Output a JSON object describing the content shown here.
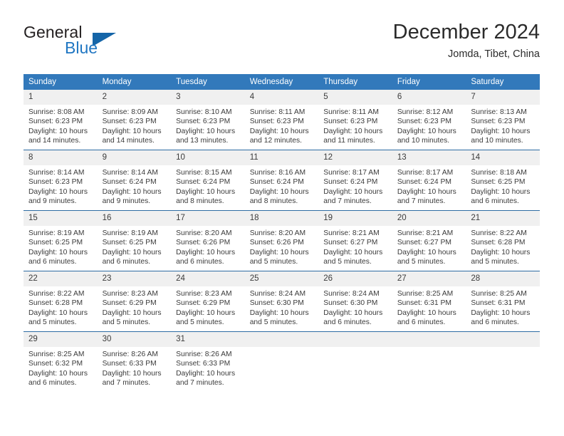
{
  "brand": {
    "name_top": "General",
    "name_bottom": "Blue",
    "accent_color": "#1565a8",
    "text_color": "#231f20"
  },
  "header": {
    "title": "December 2024",
    "subtitle": "Jomda, Tibet, China"
  },
  "theme": {
    "header_bg": "#3279bb",
    "row_divider": "#2e6da4",
    "daynum_bg": "#f0f0f0",
    "text": "#3b3b3b"
  },
  "weekdays": [
    "Sunday",
    "Monday",
    "Tuesday",
    "Wednesday",
    "Thursday",
    "Friday",
    "Saturday"
  ],
  "weeks": [
    [
      {
        "day": "1",
        "sunrise": "Sunrise: 8:08 AM",
        "sunset": "Sunset: 6:23 PM",
        "daylight": "Daylight: 10 hours and 14 minutes."
      },
      {
        "day": "2",
        "sunrise": "Sunrise: 8:09 AM",
        "sunset": "Sunset: 6:23 PM",
        "daylight": "Daylight: 10 hours and 14 minutes."
      },
      {
        "day": "3",
        "sunrise": "Sunrise: 8:10 AM",
        "sunset": "Sunset: 6:23 PM",
        "daylight": "Daylight: 10 hours and 13 minutes."
      },
      {
        "day": "4",
        "sunrise": "Sunrise: 8:11 AM",
        "sunset": "Sunset: 6:23 PM",
        "daylight": "Daylight: 10 hours and 12 minutes."
      },
      {
        "day": "5",
        "sunrise": "Sunrise: 8:11 AM",
        "sunset": "Sunset: 6:23 PM",
        "daylight": "Daylight: 10 hours and 11 minutes."
      },
      {
        "day": "6",
        "sunrise": "Sunrise: 8:12 AM",
        "sunset": "Sunset: 6:23 PM",
        "daylight": "Daylight: 10 hours and 10 minutes."
      },
      {
        "day": "7",
        "sunrise": "Sunrise: 8:13 AM",
        "sunset": "Sunset: 6:23 PM",
        "daylight": "Daylight: 10 hours and 10 minutes."
      }
    ],
    [
      {
        "day": "8",
        "sunrise": "Sunrise: 8:14 AM",
        "sunset": "Sunset: 6:23 PM",
        "daylight": "Daylight: 10 hours and 9 minutes."
      },
      {
        "day": "9",
        "sunrise": "Sunrise: 8:14 AM",
        "sunset": "Sunset: 6:24 PM",
        "daylight": "Daylight: 10 hours and 9 minutes."
      },
      {
        "day": "10",
        "sunrise": "Sunrise: 8:15 AM",
        "sunset": "Sunset: 6:24 PM",
        "daylight": "Daylight: 10 hours and 8 minutes."
      },
      {
        "day": "11",
        "sunrise": "Sunrise: 8:16 AM",
        "sunset": "Sunset: 6:24 PM",
        "daylight": "Daylight: 10 hours and 8 minutes."
      },
      {
        "day": "12",
        "sunrise": "Sunrise: 8:17 AM",
        "sunset": "Sunset: 6:24 PM",
        "daylight": "Daylight: 10 hours and 7 minutes."
      },
      {
        "day": "13",
        "sunrise": "Sunrise: 8:17 AM",
        "sunset": "Sunset: 6:24 PM",
        "daylight": "Daylight: 10 hours and 7 minutes."
      },
      {
        "day": "14",
        "sunrise": "Sunrise: 8:18 AM",
        "sunset": "Sunset: 6:25 PM",
        "daylight": "Daylight: 10 hours and 6 minutes."
      }
    ],
    [
      {
        "day": "15",
        "sunrise": "Sunrise: 8:19 AM",
        "sunset": "Sunset: 6:25 PM",
        "daylight": "Daylight: 10 hours and 6 minutes."
      },
      {
        "day": "16",
        "sunrise": "Sunrise: 8:19 AM",
        "sunset": "Sunset: 6:25 PM",
        "daylight": "Daylight: 10 hours and 6 minutes."
      },
      {
        "day": "17",
        "sunrise": "Sunrise: 8:20 AM",
        "sunset": "Sunset: 6:26 PM",
        "daylight": "Daylight: 10 hours and 6 minutes."
      },
      {
        "day": "18",
        "sunrise": "Sunrise: 8:20 AM",
        "sunset": "Sunset: 6:26 PM",
        "daylight": "Daylight: 10 hours and 5 minutes."
      },
      {
        "day": "19",
        "sunrise": "Sunrise: 8:21 AM",
        "sunset": "Sunset: 6:27 PM",
        "daylight": "Daylight: 10 hours and 5 minutes."
      },
      {
        "day": "20",
        "sunrise": "Sunrise: 8:21 AM",
        "sunset": "Sunset: 6:27 PM",
        "daylight": "Daylight: 10 hours and 5 minutes."
      },
      {
        "day": "21",
        "sunrise": "Sunrise: 8:22 AM",
        "sunset": "Sunset: 6:28 PM",
        "daylight": "Daylight: 10 hours and 5 minutes."
      }
    ],
    [
      {
        "day": "22",
        "sunrise": "Sunrise: 8:22 AM",
        "sunset": "Sunset: 6:28 PM",
        "daylight": "Daylight: 10 hours and 5 minutes."
      },
      {
        "day": "23",
        "sunrise": "Sunrise: 8:23 AM",
        "sunset": "Sunset: 6:29 PM",
        "daylight": "Daylight: 10 hours and 5 minutes."
      },
      {
        "day": "24",
        "sunrise": "Sunrise: 8:23 AM",
        "sunset": "Sunset: 6:29 PM",
        "daylight": "Daylight: 10 hours and 5 minutes."
      },
      {
        "day": "25",
        "sunrise": "Sunrise: 8:24 AM",
        "sunset": "Sunset: 6:30 PM",
        "daylight": "Daylight: 10 hours and 5 minutes."
      },
      {
        "day": "26",
        "sunrise": "Sunrise: 8:24 AM",
        "sunset": "Sunset: 6:30 PM",
        "daylight": "Daylight: 10 hours and 6 minutes."
      },
      {
        "day": "27",
        "sunrise": "Sunrise: 8:25 AM",
        "sunset": "Sunset: 6:31 PM",
        "daylight": "Daylight: 10 hours and 6 minutes."
      },
      {
        "day": "28",
        "sunrise": "Sunrise: 8:25 AM",
        "sunset": "Sunset: 6:31 PM",
        "daylight": "Daylight: 10 hours and 6 minutes."
      }
    ],
    [
      {
        "day": "29",
        "sunrise": "Sunrise: 8:25 AM",
        "sunset": "Sunset: 6:32 PM",
        "daylight": "Daylight: 10 hours and 6 minutes."
      },
      {
        "day": "30",
        "sunrise": "Sunrise: 8:26 AM",
        "sunset": "Sunset: 6:33 PM",
        "daylight": "Daylight: 10 hours and 7 minutes."
      },
      {
        "day": "31",
        "sunrise": "Sunrise: 8:26 AM",
        "sunset": "Sunset: 6:33 PM",
        "daylight": "Daylight: 10 hours and 7 minutes."
      },
      {
        "day": "",
        "sunrise": "",
        "sunset": "",
        "daylight": ""
      },
      {
        "day": "",
        "sunrise": "",
        "sunset": "",
        "daylight": ""
      },
      {
        "day": "",
        "sunrise": "",
        "sunset": "",
        "daylight": ""
      },
      {
        "day": "",
        "sunrise": "",
        "sunset": "",
        "daylight": ""
      }
    ]
  ]
}
